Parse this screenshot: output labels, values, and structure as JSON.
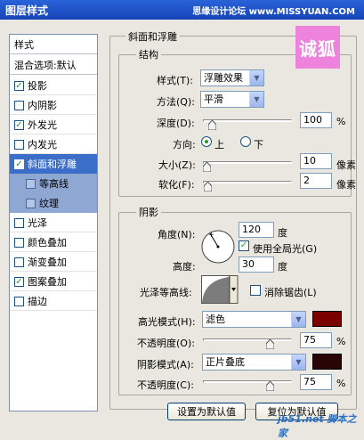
{
  "window": {
    "title": "图层样式",
    "watermark_top": "思缘设计论坛 www.MISSYUAN.COM",
    "stamp_text": "诚狐",
    "watermark_bottom": "jb51.net 脚本之家"
  },
  "sidebar": {
    "header": "样式",
    "blend_options": "混合选项:默认",
    "items": [
      {
        "label": "投影",
        "checked": true
      },
      {
        "label": "内阴影",
        "checked": false
      },
      {
        "label": "外发光",
        "checked": true
      },
      {
        "label": "内发光",
        "checked": false
      },
      {
        "label": "斜面和浮雕",
        "checked": true,
        "selected": true
      },
      {
        "label": "等高线",
        "checked": false,
        "sub": true
      },
      {
        "label": "纹理",
        "checked": false,
        "sub": true
      },
      {
        "label": "光泽",
        "checked": false
      },
      {
        "label": "颜色叠加",
        "checked": false
      },
      {
        "label": "渐变叠加",
        "checked": false
      },
      {
        "label": "图案叠加",
        "checked": true
      },
      {
        "label": "描边",
        "checked": false
      }
    ]
  },
  "bevel": {
    "title": "斜面和浮雕",
    "structure": {
      "title": "结构",
      "style_label": "样式(T):",
      "style_value": "浮雕效果",
      "technique_label": "方法(Q):",
      "technique_value": "平滑",
      "depth_label": "深度(D):",
      "depth_value": "100",
      "depth_unit": "%",
      "depth_slider": 0.1,
      "direction_label": "方向:",
      "direction_up": "上",
      "direction_down": "下",
      "size_label": "大小(Z):",
      "size_value": "10",
      "size_unit": "像素",
      "size_slider": 0.04,
      "soften_label": "软化(F):",
      "soften_value": "2",
      "soften_unit": "像素",
      "soften_slider": 0.05
    },
    "shading": {
      "title": "阴影",
      "angle_label": "角度(N):",
      "angle_value": "120",
      "angle_unit": "度",
      "global_light_label": "使用全局光(G)",
      "altitude_label": "高度:",
      "altitude_value": "30",
      "altitude_unit": "度",
      "gloss_contour_label": "光泽等高线:",
      "anti_alias_label": "消除锯齿(L)",
      "highlight_mode_label": "高光模式(H):",
      "highlight_mode_value": "滤色",
      "highlight_color": "#7a0000",
      "highlight_opacity_label": "不透明度(O):",
      "highlight_opacity_value": "75",
      "highlight_opacity_unit": "%",
      "highlight_opacity_slider": 0.75,
      "shadow_mode_label": "阴影模式(A):",
      "shadow_mode_value": "正片叠底",
      "shadow_color": "#2a0505",
      "shadow_opacity_label": "不透明度(C):",
      "shadow_opacity_value": "75",
      "shadow_opacity_unit": "%",
      "shadow_opacity_slider": 0.75
    },
    "buttons": {
      "make_default": "设置为默认值",
      "reset_default": "复位为默认值"
    }
  }
}
